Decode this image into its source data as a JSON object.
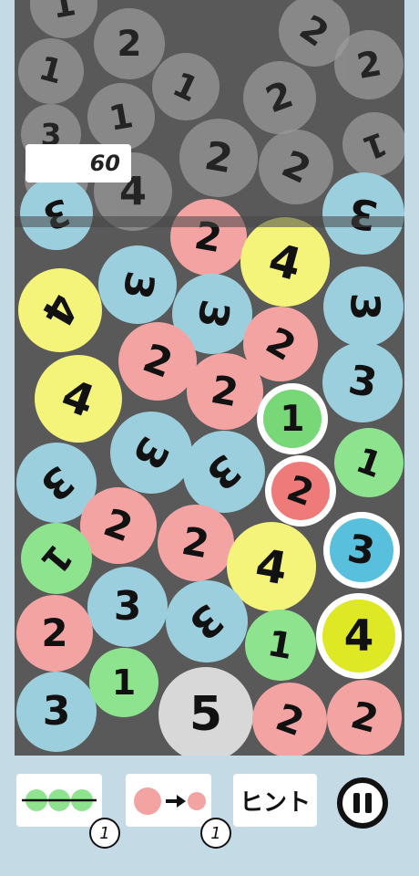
{
  "timer": {
    "value": "60"
  },
  "colors": {
    "1": "#8ee48e",
    "2": "#f4a3a3",
    "3": "#9ccfde",
    "4": "#f4f47a",
    "5": "#d8d8d8",
    "grey": "#9b9b9b",
    "chain_1": "#78d878",
    "chain_2": "#ef7a7a",
    "chain_3": "#58bfdc",
    "chain_4": "#dfe824",
    "board": "#595959",
    "background": "#c4dae4"
  },
  "queue_balls": [
    {
      "n": "1",
      "rot": -10
    },
    {
      "n": "2",
      "rot": 0
    },
    {
      "n": "1",
      "rot": 15
    },
    {
      "n": "2",
      "rot": 35
    },
    {
      "n": "1",
      "rot": 25
    },
    {
      "n": "2",
      "rot": -10
    },
    {
      "n": "1",
      "rot": -10
    },
    {
      "n": "2",
      "rot": -20
    },
    {
      "n": "3",
      "rot": 0
    },
    {
      "n": "2",
      "rot": 10
    },
    {
      "n": "2",
      "rot": 25
    },
    {
      "n": "4",
      "rot": 0
    },
    {
      "n": "1",
      "rot": 160
    },
    {
      "n": "4",
      "rot": 180
    }
  ],
  "board_balls": [
    {
      "n": "3",
      "color": "3",
      "rot": 160
    },
    {
      "n": "3",
      "color": "3",
      "rot": 190
    },
    {
      "n": "2",
      "color": "2",
      "rot": 10
    },
    {
      "n": "4",
      "color": "4",
      "rot": 15
    },
    {
      "n": "4",
      "color": "4",
      "rot": 120
    },
    {
      "n": "3",
      "color": "3",
      "rot": 100
    },
    {
      "n": "3",
      "color": "3",
      "rot": 100
    },
    {
      "n": "3",
      "color": "3",
      "rot": 90
    },
    {
      "n": "2",
      "color": "2",
      "rot": 30
    },
    {
      "n": "2",
      "color": "2",
      "rot": 20
    },
    {
      "n": "4",
      "color": "4",
      "rot": 20
    },
    {
      "n": "2",
      "color": "2",
      "rot": 10
    },
    {
      "n": "3",
      "color": "3",
      "rot": 10
    },
    {
      "n": "1",
      "color": "chain_1",
      "rot": 0,
      "chain": true
    },
    {
      "n": "3",
      "color": "3",
      "rot": 120
    },
    {
      "n": "3",
      "color": "3",
      "rot": 140
    },
    {
      "n": "3",
      "color": "3",
      "rot": 140
    },
    {
      "n": "1",
      "color": "1",
      "rot": 20
    },
    {
      "n": "2",
      "color": "chain_2",
      "rot": 20,
      "chain": true
    },
    {
      "n": "2",
      "color": "2",
      "rot": 20
    },
    {
      "n": "2",
      "color": "2",
      "rot": 10
    },
    {
      "n": "3",
      "color": "chain_3",
      "rot": 10,
      "chain": true
    },
    {
      "n": "1",
      "color": "1",
      "rot": 130
    },
    {
      "n": "4",
      "color": "4",
      "rot": 10
    },
    {
      "n": "3",
      "color": "3",
      "rot": 0
    },
    {
      "n": "3",
      "color": "3",
      "rot": 140
    },
    {
      "n": "2",
      "color": "2",
      "rot": 0
    },
    {
      "n": "1",
      "color": "1",
      "rot": 10
    },
    {
      "n": "4",
      "color": "chain_4",
      "rot": 0,
      "chain": true
    },
    {
      "n": "3",
      "color": "3",
      "rot": 0
    },
    {
      "n": "1",
      "color": "1",
      "rot": 0
    },
    {
      "n": "5",
      "color": "5",
      "rot": 0
    },
    {
      "n": "2",
      "color": "2",
      "rot": 20
    },
    {
      "n": "2",
      "color": "2",
      "rot": 15
    }
  ],
  "toolbar": {
    "line_count": "1",
    "shrink_count": "1",
    "hint_label": "ヒント",
    "line_icon": "three-balls-line-icon",
    "shrink_icon": "ball-shrink-icon",
    "pause_icon": "pause-icon"
  }
}
